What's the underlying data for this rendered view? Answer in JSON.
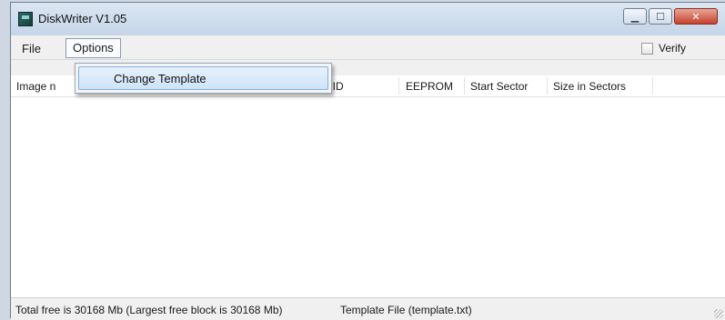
{
  "window": {
    "title": "DiskWriter V1.05"
  },
  "menu": {
    "file": "File",
    "options": "Options",
    "dropdown_items": [
      "Change Template"
    ]
  },
  "verify": {
    "label": "Verify",
    "checked": false
  },
  "table": {
    "columns": [
      "Image n",
      "le ID",
      "EEPROM",
      "Start Sector",
      "Size in Sectors"
    ]
  },
  "status": {
    "free_space": "Total free is 30168 Mb  (Largest free block is 30168 Mb)",
    "template": "Template File (template.txt)"
  },
  "colors": {
    "title_bar": "#c5d5e8",
    "close_button": "#c4422d",
    "menu_highlight": "#cfe3f8"
  }
}
